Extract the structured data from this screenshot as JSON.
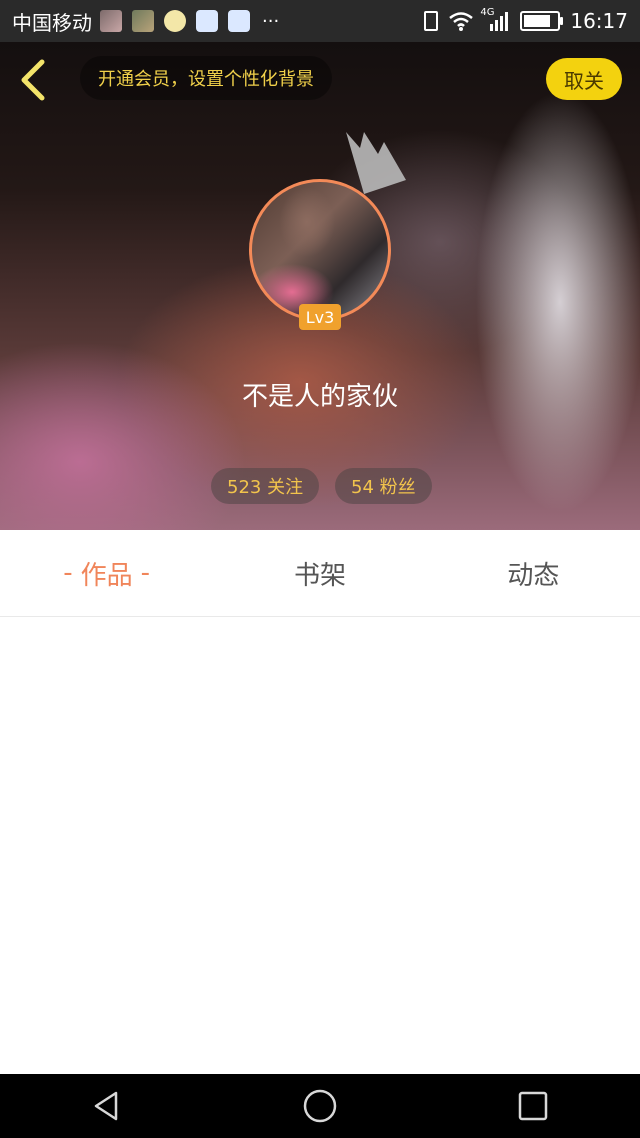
{
  "status_bar": {
    "carrier": "中国移动",
    "more": "···",
    "network": "4G",
    "time": "16:17"
  },
  "header": {
    "promo_text": "开通会员，设置个性化背景",
    "cancel_label": "取关",
    "level_badge": "Lv3",
    "nickname": "不是人的家伙",
    "following": "523 关注",
    "fans": "54 粉丝"
  },
  "tabs": [
    {
      "label": "作品",
      "active": true
    },
    {
      "label": "书架",
      "active": false
    },
    {
      "label": "动态",
      "active": false
    }
  ],
  "colors": {
    "accent_orange": "#f0855a",
    "accent_yellow": "#f3d20f",
    "stat_text": "#f2c44c"
  },
  "icons": {
    "back": "chevron-left-icon",
    "crown": "crown-icon",
    "nav_back": "triangle-back-icon",
    "nav_home": "circle-home-icon",
    "nav_recent": "square-recent-icon"
  }
}
